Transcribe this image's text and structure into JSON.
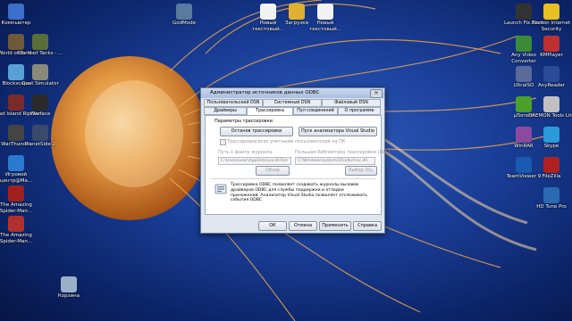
{
  "desktop": {
    "icons_left": [
      {
        "label": "Компьютер",
        "color": "#3b6fc9"
      },
      {
        "label": "World of Tanks",
        "color": "#6e5a3a"
      },
      {
        "label": "World of Tanks - ...",
        "color": "#5b6e3a"
      },
      {
        "label": "Blockscape",
        "color": "#5aa0d8"
      },
      {
        "label": "Goat Simulator",
        "color": "#8a8a7a"
      },
      {
        "label": "Dead Island Riptide",
        "color": "#7a2a2a"
      },
      {
        "label": "Warface",
        "color": "#2a2a2a"
      },
      {
        "label": "WarThunder",
        "color": "#444444"
      },
      {
        "label": "PlanetSide 2",
        "color": "#3a4a6a"
      },
      {
        "label": "Игровой центр@Ma...",
        "color": "#2a7ad0"
      },
      {
        "label": "The Amazing Spider-Man...",
        "color": "#a02020"
      },
      {
        "label": "The Amazing Spider-Man...",
        "color": "#b03030"
      },
      {
        "label": "Корзина",
        "color": "#9ab0c8"
      }
    ],
    "icons_top": [
      {
        "label": "GodMode",
        "color": "#5a7aa0"
      },
      {
        "label": "Новый текстовый...",
        "color": "#f2f2f2"
      },
      {
        "label": "Загрузки",
        "color": "#e0b030"
      },
      {
        "label": "Новый текстовый...",
        "color": "#f2f2f2"
      }
    ],
    "icons_right": [
      {
        "label": "Launch Fix.Ease",
        "color": "#333333"
      },
      {
        "label": "Norton Internet Security",
        "color": "#e8c020"
      },
      {
        "label": "Any Video Converter",
        "color": "#3a8a3a"
      },
      {
        "label": "KMPlayer",
        "color": "#c03030"
      },
      {
        "label": "UltraISO",
        "color": "#5a6a9a"
      },
      {
        "label": "AnyReader",
        "color": "#2a4a9a"
      },
      {
        "label": "µTorrent",
        "color": "#4aa02a"
      },
      {
        "label": "DAEMON Tools Lite",
        "color": "#c0c0c0"
      },
      {
        "label": "WinRAR",
        "color": "#8a4aa0"
      },
      {
        "label": "Skype",
        "color": "#2a9ad8"
      },
      {
        "label": "TeamViewer 9",
        "color": "#1a5ab0"
      },
      {
        "label": "FileZilla",
        "color": "#b02020"
      },
      {
        "label": "HD Tune Pro",
        "color": "#2a6ab0"
      }
    ]
  },
  "dialog": {
    "title": "Администратор источников данных ODBC",
    "close_glyph": "✕",
    "tabs_row1": [
      "Пользовательский DSN",
      "Системный DSN",
      "Файловый DSN"
    ],
    "tabs_row2": [
      "Драйверы",
      "Трассировка",
      "Пул соединений",
      "О программе"
    ],
    "group_label": "Параметры трассировки",
    "btn_stop": "Останов трассировки",
    "btn_vs": "Пуск анализатора Visual Studio",
    "chk_label": "Трассировка всех учетными пользователей на ПК",
    "log_label": "Путь к файлу журнала",
    "log_value": "C:\\Users\\user\\AppData\\Local\\Tem",
    "dll_label": "Польшая библиотека трассировки (DLL)",
    "dll_value": "C:\\Windows\\system32\\odbctrac.dll",
    "browse1": "Обзор",
    "browse2": "Выбор DLL",
    "info_text": "Трассировка ODBC позволяет создавать журналы вызовов драйверов ODBC для службы поддержки и отладки приложений. Анализатор Visual Studio позволяет отслеживать события ODBC",
    "ok": "ОК",
    "cancel": "Отмена",
    "apply": "Применить",
    "help": "Справка"
  }
}
